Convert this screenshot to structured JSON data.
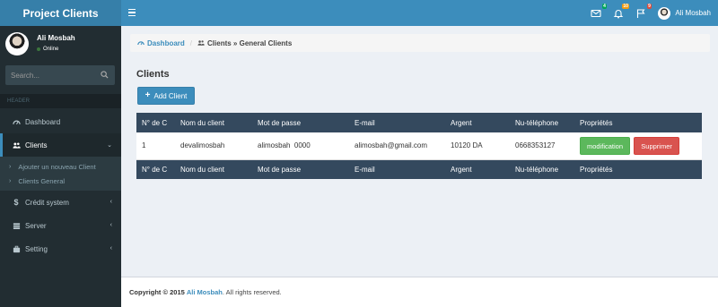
{
  "app": {
    "brand": "Project Clients"
  },
  "topbar": {
    "badges": {
      "messages": "4",
      "notifications": "10",
      "tasks": "9"
    },
    "user_name": "Ali Mosbah"
  },
  "sidebar": {
    "user": {
      "name": "Ali Mosbah",
      "status": "Online"
    },
    "search_placeholder": "Search...",
    "section_header": "HEADER",
    "items": [
      {
        "label": "Dashboard",
        "icon": "dashboard-icon"
      },
      {
        "label": "Clients",
        "icon": "users-icon"
      },
      {
        "label": "Crédit system",
        "icon": "dollar-icon"
      },
      {
        "label": "Server",
        "icon": "server-icon"
      },
      {
        "label": "Setting",
        "icon": "briefcase-icon"
      }
    ],
    "submenu": [
      {
        "label": "Ajouter un nouveau Client"
      },
      {
        "label": "Clients General"
      }
    ]
  },
  "breadcrumb": {
    "home": "Dashboard",
    "current": "Clients » General Clients"
  },
  "page": {
    "title": "Clients",
    "add_button": "Add Client"
  },
  "table": {
    "headers": [
      "N° de C",
      "Nom du client",
      "Mot de passe",
      "E-mail",
      "Argent",
      "Nu-téléphone",
      "Propriétés"
    ],
    "rows": [
      {
        "num": "1",
        "name": "devalimosbah",
        "password": "alimosbah  0000",
        "email": "alimosbah@gmail.com",
        "money": "10120 DA",
        "phone": "0668353127",
        "edit_label": "modification",
        "delete_label": "Supprimer"
      }
    ]
  },
  "footer": {
    "prefix": "Copyright © 2015",
    "author": "Ali Mosbah",
    "suffix": ". All rights reserved."
  },
  "colors": {
    "primary": "#3c8dbc",
    "sidebar": "#222d32",
    "success": "#5cb85c",
    "danger": "#d9534f",
    "table_header": "#34495e"
  }
}
